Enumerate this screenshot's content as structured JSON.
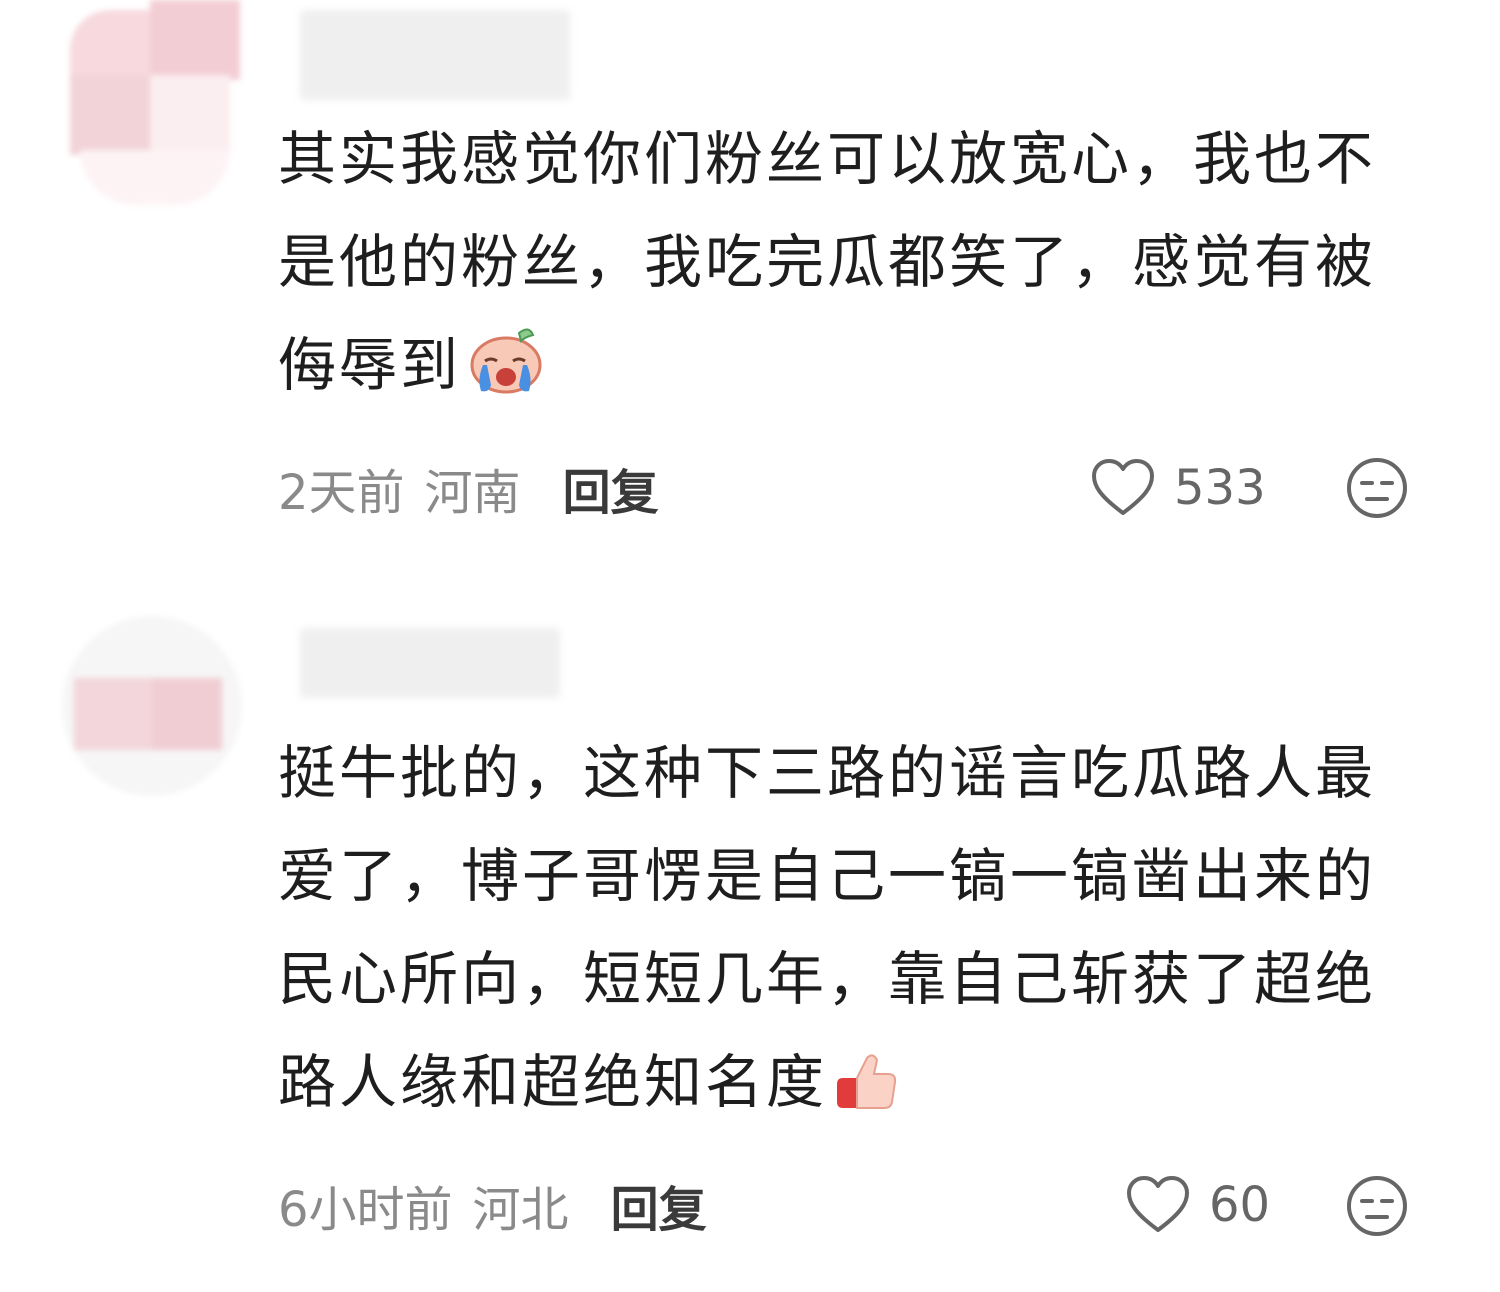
{
  "comments": [
    {
      "text": "其实我感觉你们粉丝可以放宽心，我也不是他的粉丝，我吃完瓜都笑了，感觉有被侮辱到",
      "emoji": "crying-face-icon",
      "time": "2天前",
      "location": "河南",
      "reply_label": "回复",
      "likes": "533"
    },
    {
      "text": "挺牛批的，这种下三路的谣言吃瓜路人最爱了，博子哥愣是自己一镐一镐凿出来的民心所向，短短几年，靠自己斩获了超绝路人缘和超绝知名度",
      "emoji": "thumbs-up-icon",
      "time": "6小时前",
      "location": "河北",
      "reply_label": "回复",
      "likes": "60"
    }
  ],
  "colors": {
    "text": "#1e1e1e",
    "meta": "#8a8a8a",
    "reply": "#3a3a3a",
    "icon": "#666666"
  }
}
